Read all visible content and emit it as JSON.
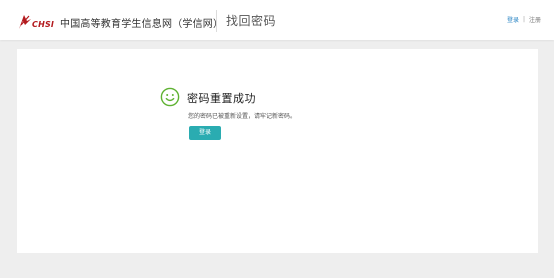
{
  "header": {
    "logo_text": "CHSI",
    "site_name": "中国高等教育学生信息网（学信网）",
    "page_title": "找回密码",
    "login_label": "登录",
    "separator": "|",
    "register_label": "注册"
  },
  "main": {
    "success_title": "密码重置成功",
    "success_message": "您的密码已被重新设置，请牢记新密码。",
    "login_button_label": "登录"
  },
  "icons": {
    "logo": "chsi-logo-icon",
    "smiley": "smiley-icon"
  },
  "colors": {
    "brand_red": "#b31a1e",
    "link_blue": "#2a84c4",
    "success_green": "#5fb233",
    "button_teal": "#2aacb1",
    "page_background": "#eeeeee",
    "panel_background": "#ffffff"
  }
}
